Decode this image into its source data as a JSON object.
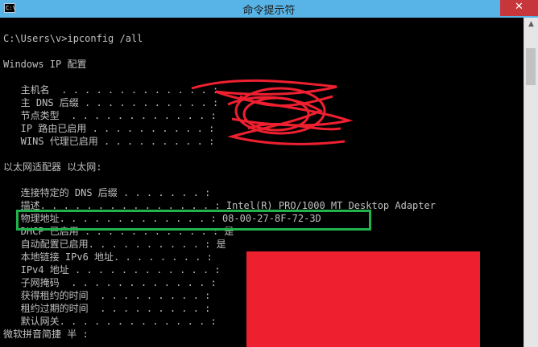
{
  "window": {
    "title": "命令提示符",
    "close_label": "✕"
  },
  "console": {
    "lines": [
      "C:\\Users\\v>ipconfig /all",
      "Windows IP 配置",
      "   主机名  . . . . . . . . . . . . . :",
      "   主 DNS 后缀 . . . . . . . . . . . :",
      "   节点类型  . . . . . . . . . . . . :",
      "   IP 路由已启用 . . . . . . . . . . :",
      "   WINS 代理已启用 . . . . . . . . . :",
      "以太网适配器 以太网:",
      "   连接特定的 DNS 后缀 . . . . . . . :",
      "   描述. . . . . . . . . . . . . . . : Intel(R) PRO/1000 MT Desktop Adapter",
      "   物理地址. . . . . . . . . . . . . : 08-00-27-8F-72-3D",
      "   DHCP 已启用 . . . . . . . . . . . : 是",
      "   自动配置已启用. . . . . . . . . . : 是",
      "   本地链接 IPv6 地址. . . . . . . . :",
      "   IPv4 地址 . . . . . . . . . . . . :",
      "   子网掩码  . . . . . . . . . . . . :",
      "   获得租约的时间  . . . . . . . . . :",
      "   租约过期的时间  . . . . . . . . . :",
      "   默认网关. . . . . . . . . . . . . :",
      "微软拼音简捷 半 :"
    ]
  },
  "colors": {
    "console_bg": "#000000",
    "console_text": "#c0c0c0",
    "titlebar": "#58b4e6",
    "close": "#c7363a",
    "highlight": "#22b14c",
    "redaction": "#ee2030"
  }
}
